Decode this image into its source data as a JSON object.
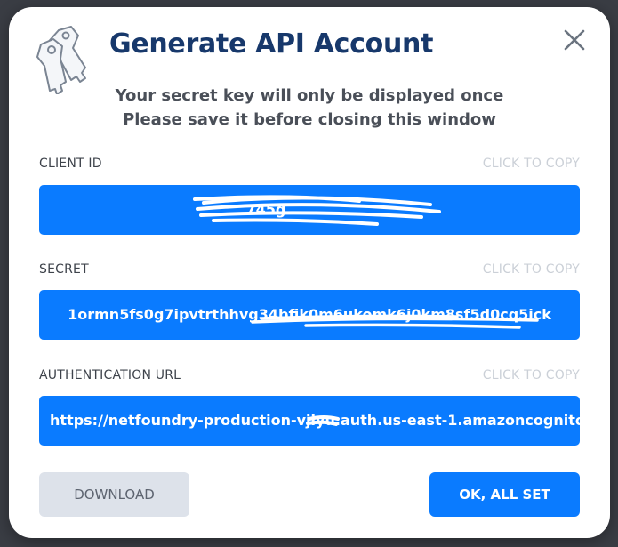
{
  "modal": {
    "title": "Generate API Account",
    "subtitle_line1": "Your secret key will only be displayed once",
    "subtitle_line2": "Please save it before closing this window"
  },
  "fields": [
    {
      "label": "CLIENT ID",
      "copy_label": "CLICK TO COPY",
      "value": "745g..."
    },
    {
      "label": "SECRET",
      "copy_label": "CLICK TO COPY",
      "value": "1ormn5fs0g7ipvtrthhvg34bfik0m6ukomk6j0km8sf5d0cq5ick"
    },
    {
      "label": "AUTHENTICATION URL",
      "copy_label": "CLICK TO COPY",
      "value": "https://netfoundry-production-vjiyu.auth.us-east-1.amazoncognito"
    }
  ],
  "buttons": {
    "download": "DOWNLOAD",
    "ok": "OK, ALL SET"
  },
  "colors": {
    "accent": "#0a7bff",
    "title": "#17386b",
    "secondary_button": "#dde2ea"
  },
  "icons": {
    "logo": "keys-icon",
    "close": "close-icon"
  }
}
